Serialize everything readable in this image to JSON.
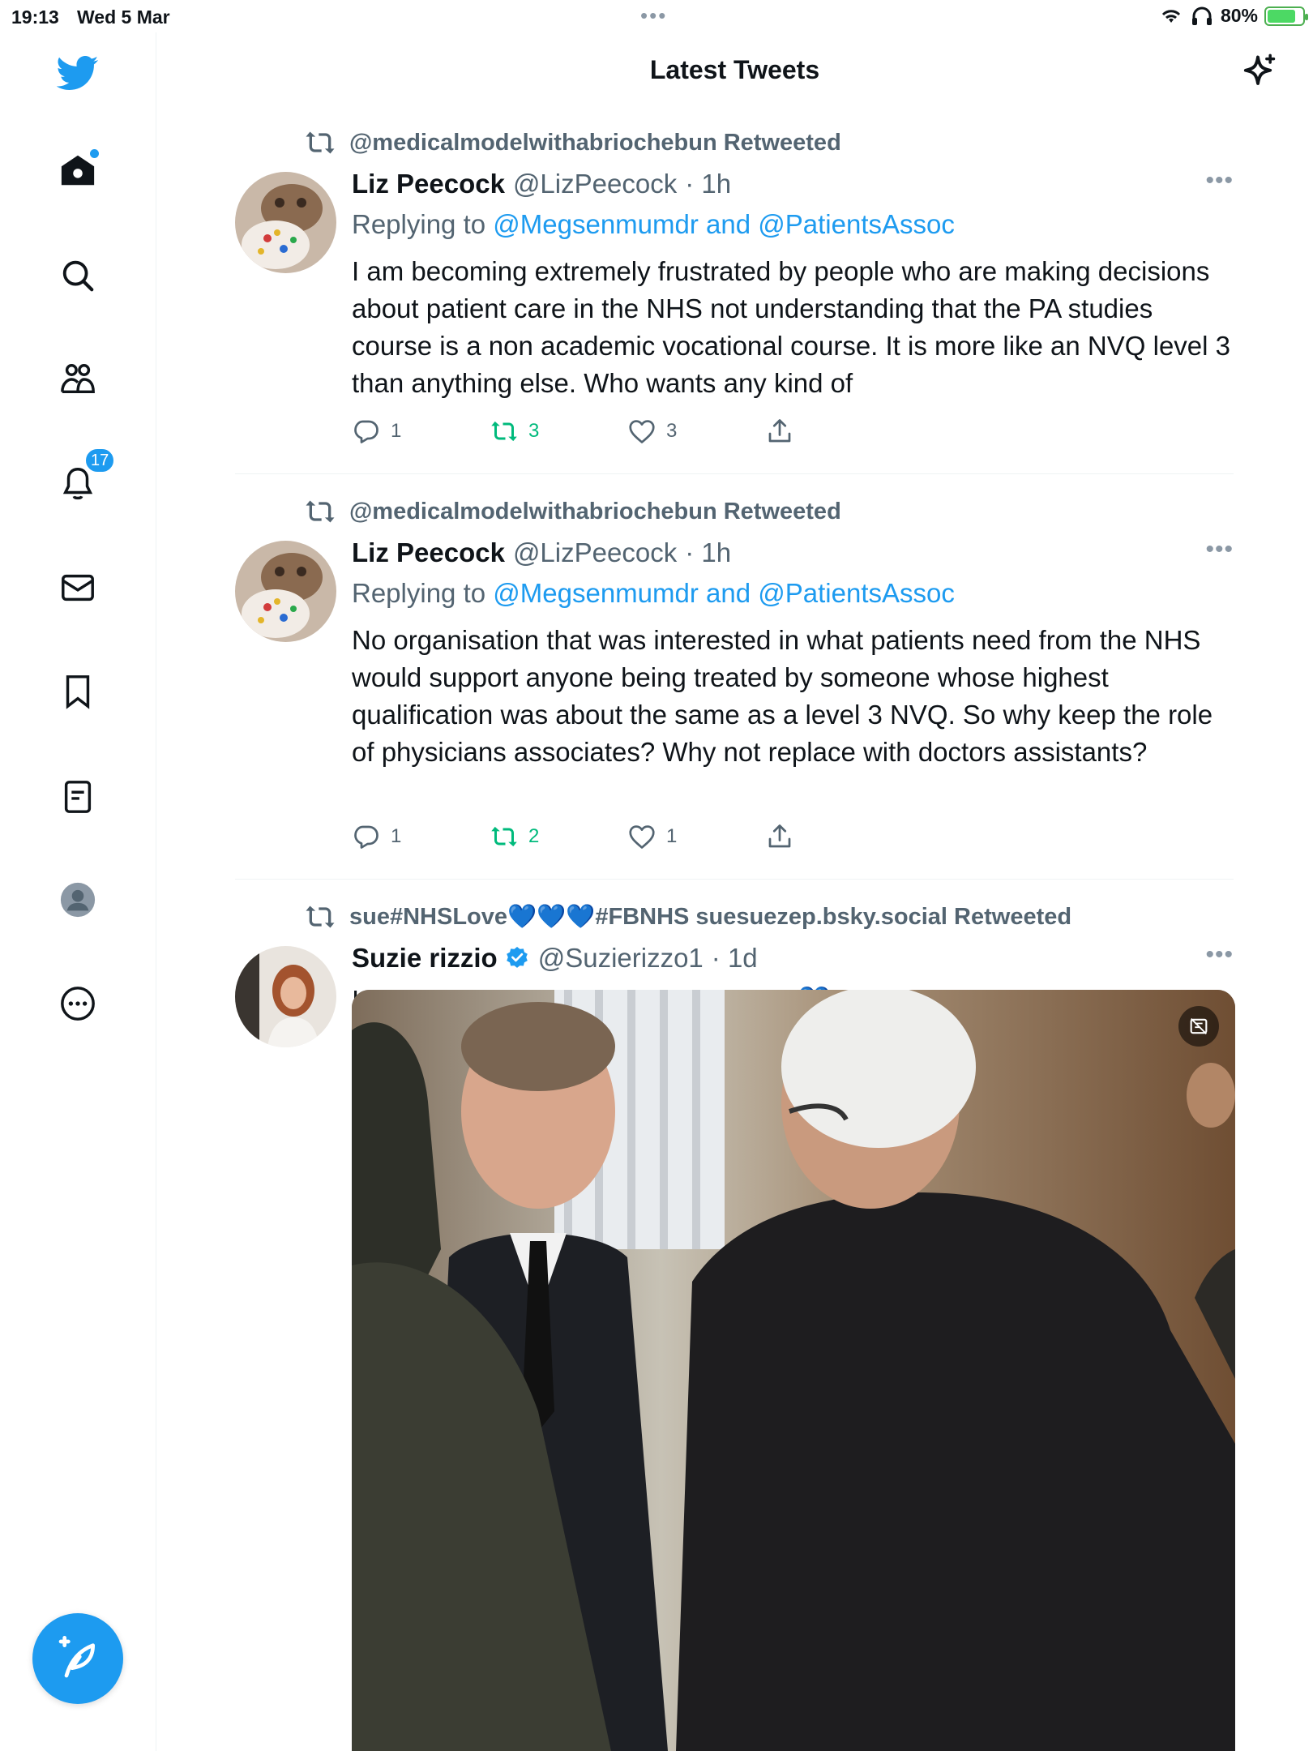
{
  "status_bar": {
    "time": "19:13",
    "date": "Wed 5 Mar",
    "battery": "80%",
    "battery_level": 0.8
  },
  "header": {
    "title": "Latest Tweets"
  },
  "sidebar": {
    "notification_count": "17",
    "items": [
      "home-icon",
      "search-icon",
      "communities-icon",
      "notifications-icon",
      "messages-icon",
      "bookmarks-icon",
      "lists-icon",
      "profile-icon",
      "more-icon"
    ]
  },
  "colors": {
    "brand": "#1d9bf0",
    "retweet_active": "#00ba7c",
    "secondary_text": "#536471"
  },
  "tweets": [
    {
      "retweeted_by": "@medicalmodelwithabriochebun Retweeted",
      "name": "Liz Peecock",
      "handle": "@LizPeecock",
      "time": "· 1h",
      "replying_prefix": "Replying to",
      "replying_to": "@Megsenmumdr and @PatientsAssoc",
      "text": "I am becoming extremely frustrated by people who are making decisions about patient care in the NHS not understanding that the PA studies course is a non academic vocational course.  It is more like an NVQ level 3 than anything else.   Who wants any kind of",
      "replies": "1",
      "retweets": "3",
      "likes": "3"
    },
    {
      "retweeted_by": "@medicalmodelwithabriochebun Retweeted",
      "name": "Liz Peecock",
      "handle": "@LizPeecock",
      "time": "· 1h",
      "replying_prefix": "Replying to",
      "replying_to": "@Megsenmumdr and @PatientsAssoc",
      "text": "No organisation that was interested in what patients need from the NHS would support anyone being treated by someone whose highest qualification was about the same as a level 3 NVQ.  So why keep the role of physicians associates?   Why not replace with doctors assistants?",
      "replies": "1",
      "retweets": "2",
      "likes": "1"
    },
    {
      "retweeted_by": "sue#NHSLove💙💙💙#FBNHS suesuezep.bsky.social Retweeted",
      "name": "Suzie rizzio",
      "handle": "@Suzierizzo1",
      "time": "· 1d",
      "text": "Italy welcoming Volodomyr Zelensky! 💙"
    }
  ]
}
